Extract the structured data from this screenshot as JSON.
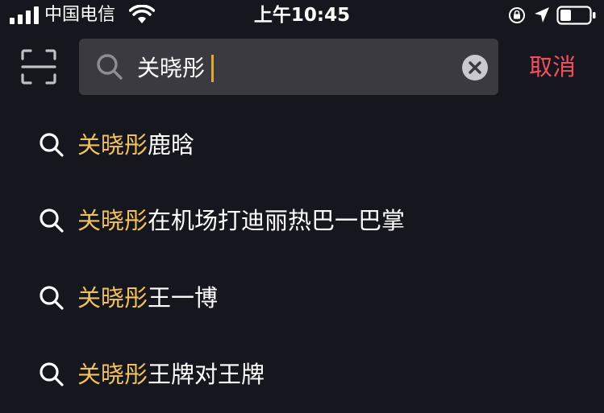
{
  "status_bar": {
    "carrier": "中国电信",
    "time": "上午10:45",
    "icons": [
      "signal-icon",
      "wifi-icon",
      "rotation-lock-icon",
      "location-icon",
      "battery-icon"
    ]
  },
  "header": {
    "scan_icon": "scan-icon",
    "search": {
      "value": "关晓彤",
      "icon": "search-icon",
      "clear_icon": "clear-icon"
    },
    "cancel_label": "取消"
  },
  "suggestions": [
    {
      "highlight": "关晓彤",
      "rest": "鹿晗"
    },
    {
      "highlight": "关晓彤",
      "rest": "在机场打迪丽热巴一巴掌"
    },
    {
      "highlight": "关晓彤",
      "rest": "王一博"
    },
    {
      "highlight": "关晓彤",
      "rest": "王牌对王牌"
    }
  ],
  "colors": {
    "background": "#16161e",
    "search_box": "#3a3a40",
    "highlight": "#f1c15a",
    "cancel": "#f0505e"
  }
}
